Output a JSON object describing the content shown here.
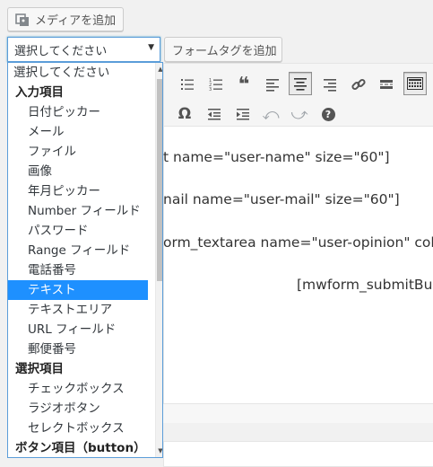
{
  "buttons": {
    "add_media": "メディアを追加",
    "add_form_tag": "フォームタグを追加"
  },
  "select": {
    "value": "選択してください"
  },
  "dropdown": {
    "options": [
      {
        "label": "選択してください",
        "kind": "top"
      },
      {
        "label": "入力項目",
        "kind": "group"
      },
      {
        "label": "日付ピッカー",
        "kind": "item"
      },
      {
        "label": "メール",
        "kind": "item"
      },
      {
        "label": "ファイル",
        "kind": "item"
      },
      {
        "label": "画像",
        "kind": "item"
      },
      {
        "label": "年月ピッカー",
        "kind": "item"
      },
      {
        "label": "Number フィールド",
        "kind": "item"
      },
      {
        "label": "パスワード",
        "kind": "item"
      },
      {
        "label": "Range フィールド",
        "kind": "item"
      },
      {
        "label": "電話番号",
        "kind": "item"
      },
      {
        "label": "テキスト",
        "kind": "item",
        "selected": true
      },
      {
        "label": "テキストエリア",
        "kind": "item"
      },
      {
        "label": "URL フィールド",
        "kind": "item"
      },
      {
        "label": "郵便番号",
        "kind": "item"
      },
      {
        "label": "選択項目",
        "kind": "group"
      },
      {
        "label": "チェックボックス",
        "kind": "item"
      },
      {
        "label": "ラジオボタン",
        "kind": "item"
      },
      {
        "label": "セレクトボックス",
        "kind": "item"
      },
      {
        "label": "ボタン項目（button）",
        "kind": "group"
      }
    ]
  },
  "toolbar": {
    "row1_icons": [
      "bullet-list-icon",
      "numbered-list-icon",
      "blockquote-icon",
      "align-left-icon",
      "align-center-icon",
      "align-right-icon",
      "link-icon",
      "read-more-icon",
      "toolbar-toggle-icon"
    ],
    "row2_icons": [
      "special-char-icon",
      "outdent-icon",
      "indent-icon",
      "undo-icon",
      "redo-icon",
      "help-icon"
    ],
    "omega": "Ω",
    "help": "?"
  },
  "editor": {
    "lines": [
      "t name=\"user-name\" size=\"60\"]",
      "nail name=\"user-mail\" size=\"60\"]",
      "orm_textarea name=\"user-opinion\" col",
      "[mwform_submitBu"
    ]
  },
  "colors": {
    "selected_bg": "#1e90ff",
    "focus_border": "#5b9dd9"
  }
}
